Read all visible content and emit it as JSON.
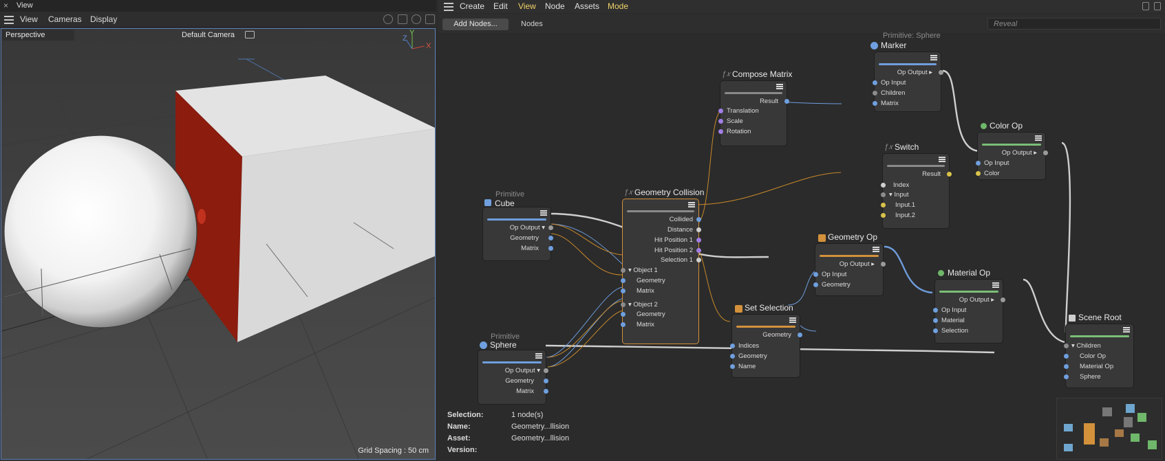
{
  "view_panel": {
    "title": "View",
    "menu": [
      "View",
      "Cameras",
      "Display"
    ],
    "viewport_label": "Perspective",
    "camera_label": "Default Camera",
    "grid_spacing": "Grid Spacing : 50 cm",
    "axis_labels": {
      "y": "Y",
      "z": "Z",
      "x": "X"
    }
  },
  "node_editor": {
    "menu": [
      "Create",
      "Edit",
      "View",
      "Node",
      "Assets",
      "Mode"
    ],
    "active_menu": [
      "View",
      "Mode"
    ],
    "add_nodes_label": "Add Nodes...",
    "tab_label": "Nodes",
    "search_placeholder": "Reveal",
    "nodes": {
      "marker": {
        "subtitle": "Primitive: Sphere",
        "title": "Marker",
        "outputs": [
          "Op Output ▸"
        ],
        "inputs": [
          "Op Input",
          "Children",
          "Matrix"
        ]
      },
      "compose_matrix": {
        "fx": "ƒ𝑥",
        "title": "Compose Matrix",
        "outputs": [
          "Result"
        ],
        "inputs": [
          "Translation",
          "Scale",
          "Rotation"
        ]
      },
      "switch": {
        "fx": "ƒ𝑥",
        "title": "Switch",
        "outputs": [
          "Result"
        ],
        "inputs": [
          "Index",
          "Input",
          "Input.1",
          "Input.2"
        ]
      },
      "color_op": {
        "title": "Color Op",
        "outputs": [
          "Op Output ▸"
        ],
        "inputs": [
          "Op Input",
          "Color"
        ]
      },
      "cube": {
        "subtitle": "Primitive",
        "title": "Cube",
        "outputs": [
          "Op Output ▾",
          "Geometry",
          "Matrix"
        ]
      },
      "geometry_collision": {
        "fx": "ƒ𝑥",
        "title": "Geometry Collision",
        "outputs": [
          "Collided",
          "Distance",
          "Hit Position 1",
          "Hit Position 2",
          "Selection 1"
        ],
        "inputs": [
          "Object 1",
          "Geometry",
          "Matrix",
          "Object 2",
          "Geometry",
          "Matrix"
        ]
      },
      "geometry_op": {
        "title": "Geometry Op",
        "outputs": [
          "Op Output ▸"
        ],
        "inputs": [
          "Op Input",
          "Geometry"
        ]
      },
      "material_op": {
        "title": "Material Op",
        "outputs": [
          "Op Output ▸"
        ],
        "inputs": [
          "Op Input",
          "Material",
          "Selection"
        ]
      },
      "set_selection": {
        "title": "Set Selection",
        "outputs": [
          "Geometry"
        ],
        "inputs": [
          "Indices",
          "Geometry",
          "Name"
        ]
      },
      "scene_root": {
        "title": "Scene Root",
        "inputs": [
          "Children",
          "Color Op",
          "Material Op",
          "Sphere"
        ]
      },
      "sphere": {
        "subtitle": "Primitive",
        "title": "Sphere",
        "outputs": [
          "Op Output ▾",
          "Geometry",
          "Matrix"
        ]
      }
    },
    "info": {
      "selection_key": "Selection:",
      "selection_val": "1 node(s)",
      "name_key": "Name:",
      "name_val": "Geometry...llision",
      "asset_key": "Asset:",
      "asset_val": "Geometry...llision",
      "version_key": "Version:"
    }
  },
  "colors": {
    "geometry_port": "#6f9fde",
    "matrix_port": "#6f9fde",
    "vector_port": "#a27fe6",
    "color_port": "#d9c24a",
    "generic_port": "#8c8c8c",
    "selected_outline": "#d3913b",
    "red_face": "#8b1c0e"
  }
}
